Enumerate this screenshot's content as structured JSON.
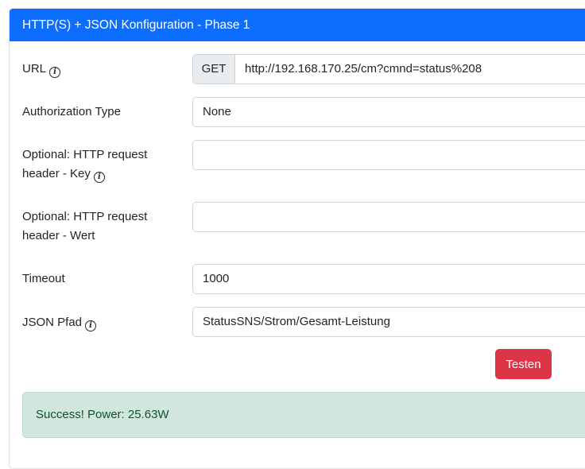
{
  "card": {
    "title": "HTTP(S) + JSON Konfiguration - Phase 1"
  },
  "fields": {
    "url": {
      "label": "URL",
      "method": "GET",
      "value": "http://192.168.170.25/cm?cmnd=status%208"
    },
    "auth_type": {
      "label": "Authorization Type",
      "value": "None"
    },
    "header_key": {
      "label_line1": "Optional: HTTP request",
      "label_line2": "header - Key",
      "value": ""
    },
    "header_value": {
      "label_line1": "Optional: HTTP request",
      "label_line2": "header - Wert",
      "value": ""
    },
    "timeout": {
      "label": "Timeout",
      "value": "1000"
    },
    "json_path": {
      "label": "JSON Pfad",
      "value": "StatusSNS/Strom/Gesamt-Leistung"
    }
  },
  "buttons": {
    "test_label": "Testen"
  },
  "alert": {
    "message": "Success! Power: 25.63W"
  },
  "icons": {
    "info": "info-circle-icon"
  },
  "colors": {
    "header_bg": "#0d6efd",
    "button_danger": "#dc3545",
    "alert_success_bg": "#d1e7dd",
    "alert_success_text": "#0f5132"
  }
}
